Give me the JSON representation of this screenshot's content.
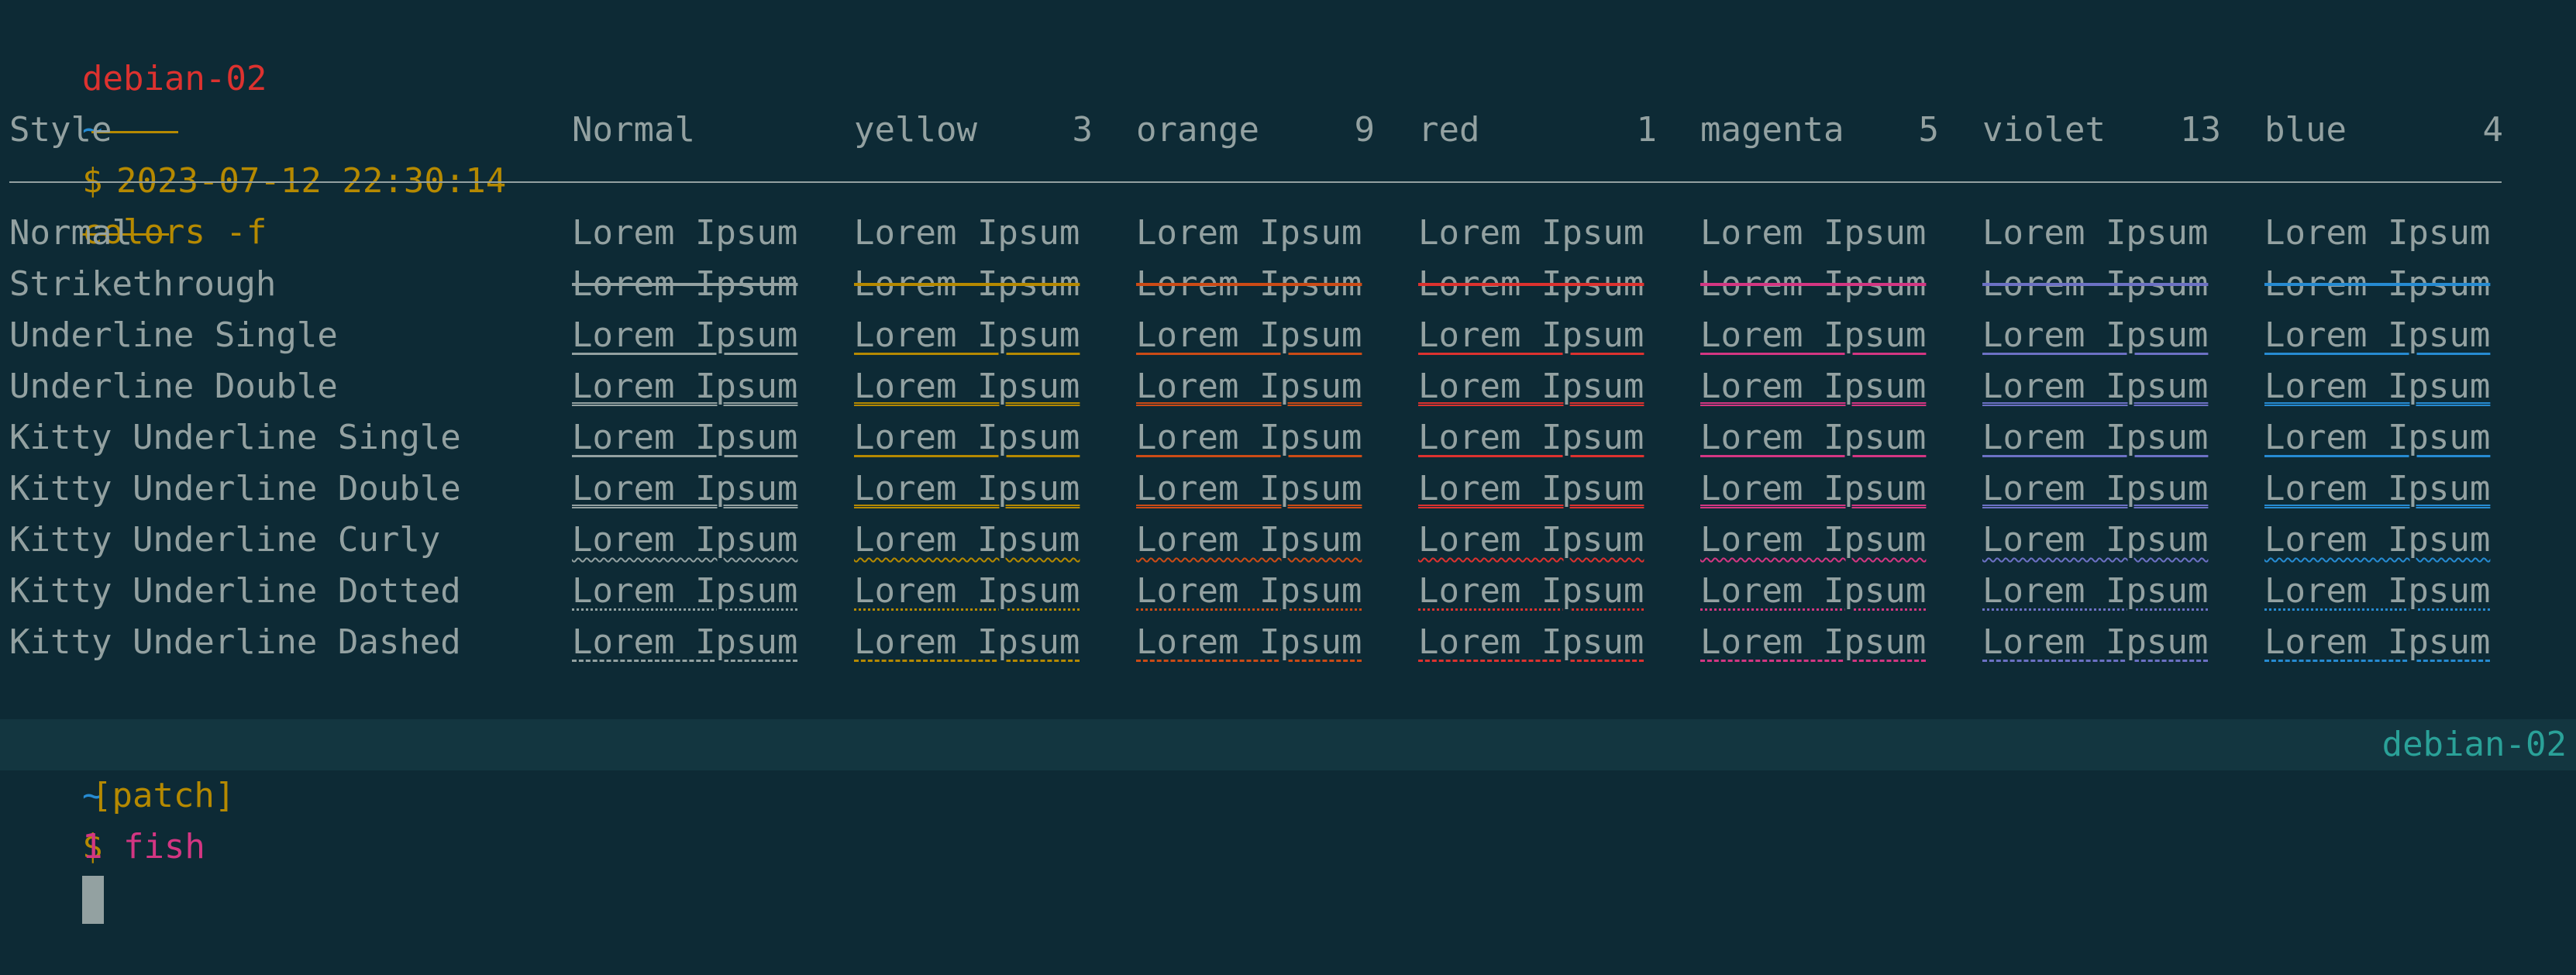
{
  "prompt1": {
    "host": "debian-02",
    "path": "~",
    "symbol": "$",
    "command": "colors -f"
  },
  "timestamp": "2023-07-12 22:30:14",
  "header": {
    "style_label": "Style",
    "columns": [
      {
        "name": "Normal",
        "code": "",
        "color": "#93a1a1"
      },
      {
        "name": "yellow",
        "code": "3",
        "color": "#b58900"
      },
      {
        "name": "orange",
        "code": "9",
        "color": "#cb4b16"
      },
      {
        "name": "red",
        "code": "1",
        "color": "#dc322f"
      },
      {
        "name": "magenta",
        "code": "5",
        "color": "#d33682"
      },
      {
        "name": "violet",
        "code": "13",
        "color": "#6c71c4"
      },
      {
        "name": "blue",
        "code": "4",
        "color": "#268bd2"
      }
    ]
  },
  "sample_text": "Lorem Ipsum",
  "styles": [
    "Normal",
    "Strikethrough",
    "Underline Single",
    "Underline Double",
    "Kitty Underline Single",
    "Kitty Underline Double",
    "Kitty Underline Curly",
    "Kitty Underline Dotted",
    "Kitty Underline Dashed"
  ],
  "prompt2": {
    "host": "debian-02",
    "path": "~",
    "symbol": "$"
  },
  "statusbar": {
    "session": "[patch]",
    "window": "1 fish",
    "hostname": "debian-02"
  }
}
